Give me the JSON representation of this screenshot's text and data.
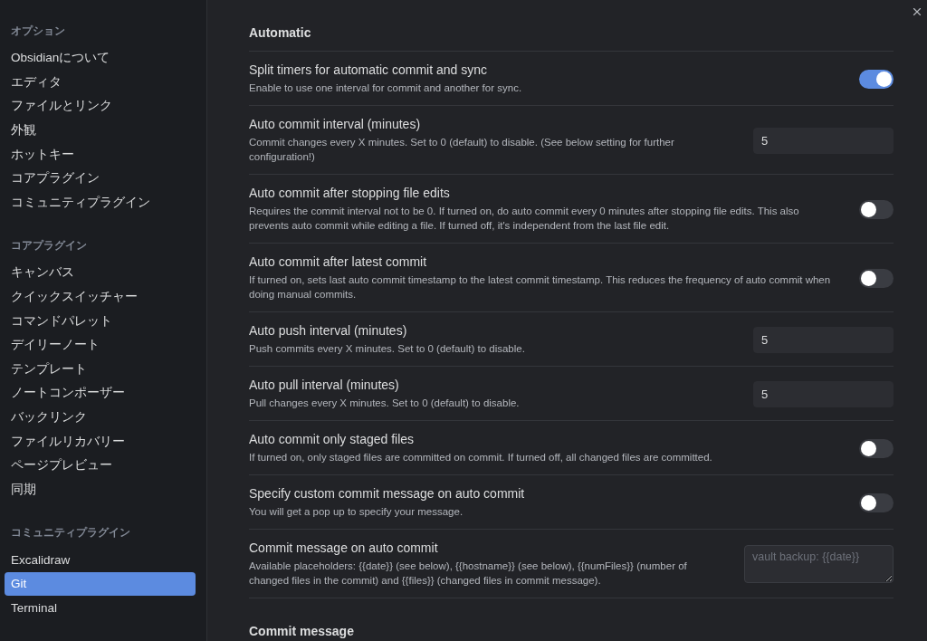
{
  "sidebar": {
    "groups": [
      {
        "heading": "オプション",
        "items": [
          {
            "label": "Obsidianについて",
            "selected": false
          },
          {
            "label": "エディタ",
            "selected": false
          },
          {
            "label": "ファイルとリンク",
            "selected": false
          },
          {
            "label": "外観",
            "selected": false
          },
          {
            "label": "ホットキー",
            "selected": false
          },
          {
            "label": "コアプラグイン",
            "selected": false
          },
          {
            "label": "コミュニティプラグイン",
            "selected": false
          }
        ]
      },
      {
        "heading": "コアプラグイン",
        "items": [
          {
            "label": "キャンバス",
            "selected": false
          },
          {
            "label": "クイックスイッチャー",
            "selected": false
          },
          {
            "label": "コマンドパレット",
            "selected": false
          },
          {
            "label": "デイリーノート",
            "selected": false
          },
          {
            "label": "テンプレート",
            "selected": false
          },
          {
            "label": "ノートコンポーザー",
            "selected": false
          },
          {
            "label": "バックリンク",
            "selected": false
          },
          {
            "label": "ファイルリカバリー",
            "selected": false
          },
          {
            "label": "ページプレビュー",
            "selected": false
          },
          {
            "label": "同期",
            "selected": false
          }
        ]
      },
      {
        "heading": "コミュニティプラグイン",
        "items": [
          {
            "label": "Excalidraw",
            "selected": false
          },
          {
            "label": "Git",
            "selected": true
          },
          {
            "label": "Terminal",
            "selected": false
          }
        ]
      }
    ]
  },
  "sections": [
    {
      "heading": "Automatic",
      "settings": [
        {
          "kind": "toggle",
          "name": "Split timers for automatic commit and sync",
          "description": "Enable to use one interval for commit and another for sync.",
          "on": true
        },
        {
          "kind": "number",
          "name": "Auto commit interval (minutes)",
          "description": "Commit changes every X minutes. Set to 0 (default) to disable. (See below setting for further configuration!)",
          "value": "5"
        },
        {
          "kind": "toggle",
          "name": "Auto commit after stopping file edits",
          "description": "Requires the commit interval not to be 0. If turned on, do auto commit every 0 minutes after stopping file edits. This also prevents auto commit while editing a file. If turned off, it's independent from the last file edit.",
          "on": false
        },
        {
          "kind": "toggle",
          "name": "Auto commit after latest commit",
          "description": "If turned on, sets last auto commit timestamp to the latest commit timestamp. This reduces the frequency of auto commit when doing manual commits.",
          "on": false
        },
        {
          "kind": "number",
          "name": "Auto push interval (minutes)",
          "description": "Push commits every X minutes. Set to 0 (default) to disable.",
          "value": "5"
        },
        {
          "kind": "number",
          "name": "Auto pull interval (minutes)",
          "description": "Pull changes every X minutes. Set to 0 (default) to disable.",
          "value": "5"
        },
        {
          "kind": "toggle",
          "name": "Auto commit only staged files",
          "description": "If turned on, only staged files are committed on commit. If turned off, all changed files are committed.",
          "on": false
        },
        {
          "kind": "toggle",
          "name": "Specify custom commit message on auto commit",
          "description": "You will get a pop up to specify your message.",
          "on": false
        },
        {
          "kind": "textarea",
          "name": "Commit message on auto commit",
          "description": "Available placeholders: {{date}} (see below), {{hostname}} (see below), {{numFiles}} (number of changed files in the commit) and {{files}} (changed files in commit message).",
          "placeholder": "vault backup: {{date}}"
        }
      ]
    },
    {
      "heading": "Commit message"
    }
  ]
}
